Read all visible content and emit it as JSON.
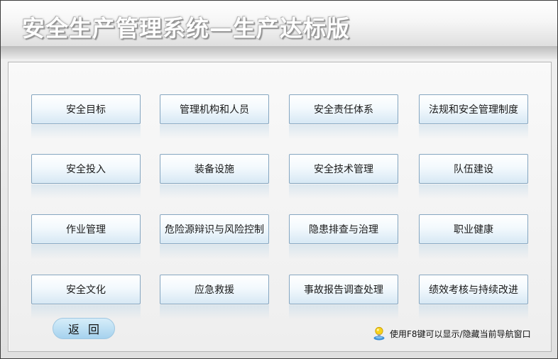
{
  "header": {
    "title": "安全生产管理系统—生产达标版"
  },
  "menu": {
    "rows": [
      [
        "安全目标",
        "管理机构和人员",
        "安全责任体系",
        "法规和安全管理制度"
      ],
      [
        "安全投入",
        "装备设施",
        "安全技术管理",
        "队伍建设"
      ],
      [
        "作业管理",
        "危险源辩识与风险控制",
        "隐患排查与治理",
        "职业健康"
      ],
      [
        "安全文化",
        "应急救援",
        "事故报告调查处理",
        "绩效考核与持续改进"
      ]
    ]
  },
  "footer": {
    "back_label": "返回",
    "hint_text": "使用F8键可以显示/隐藏当前导航窗口",
    "hint_icon": "user-lightbulb-icon"
  }
}
